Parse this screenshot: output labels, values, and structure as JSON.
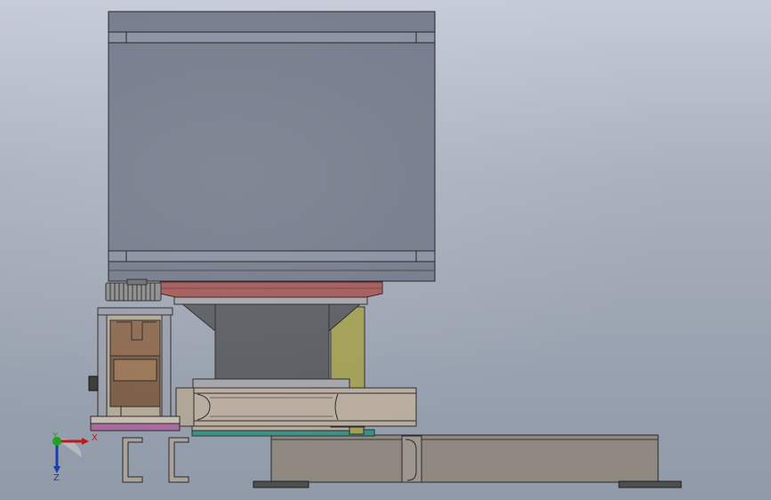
{
  "viewport": {
    "axes": {
      "x_label": "X",
      "y_label": "Y",
      "z_label": "Z"
    }
  },
  "colors": {
    "motor_body": "#747a8a",
    "motor_band": "#8890a0",
    "flange_red": "#a35a5a",
    "housing_dark": "#5a5d62",
    "housing_light": "#a3a5aa",
    "bracket_yellow": "#a29f56",
    "rail_tan": "#b9ada0",
    "base_taupe": "#8f8880",
    "bearing_brown": "#8c6a50",
    "plate_magenta": "#a86aa0",
    "plate_teal": "#3e8f88",
    "gear_grey": "#8d8d8d",
    "axis_x": "#c01818",
    "axis_y": "#22a022",
    "axis_z": "#1a3db0"
  },
  "icons": [
    "coordinate-triad-icon"
  ]
}
